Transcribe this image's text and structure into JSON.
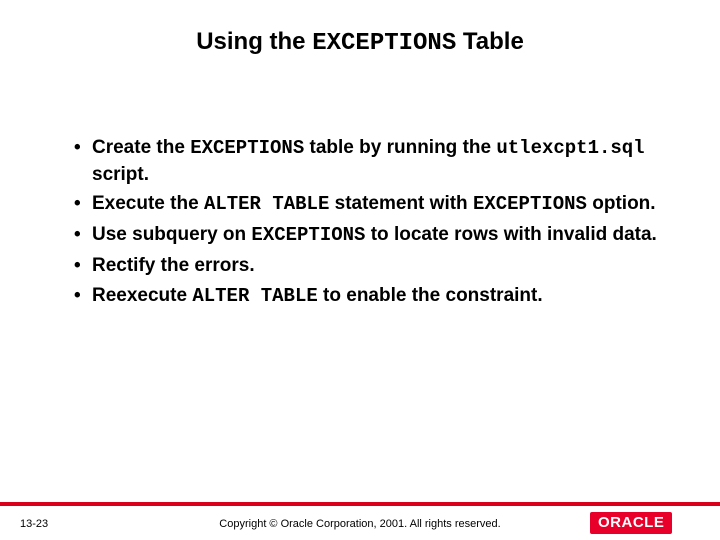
{
  "title": {
    "pre": "Using the ",
    "code": "EXCEPTIONS",
    "post": " Table"
  },
  "bullets": [
    {
      "t1": "Create the ",
      "c1": "EXCEPTIONS",
      "t2": " table by running the ",
      "c2": "utlexcpt1.sql",
      "t3": " script."
    },
    {
      "t1": "Execute the ",
      "c1": "ALTER TABLE",
      "t2": " statement with ",
      "c2": "EXCEPTIONS",
      "t3": " option."
    },
    {
      "t1": "Use subquery on ",
      "c1": "EXCEPTIONS",
      "t2": " to locate rows with invalid data.",
      "c2": "",
      "t3": ""
    },
    {
      "t1": "Rectify the errors.",
      "c1": "",
      "t2": "",
      "c2": "",
      "t3": ""
    },
    {
      "t1": "Reexecute ",
      "c1": "ALTER TABLE",
      "t2": " to enable the constraint.",
      "c2": "",
      "t3": ""
    }
  ],
  "footer": {
    "slide_num": "13-23",
    "copyright": "Copyright © Oracle Corporation, 2001. All rights reserved.",
    "logo_text": "ORACLE"
  }
}
